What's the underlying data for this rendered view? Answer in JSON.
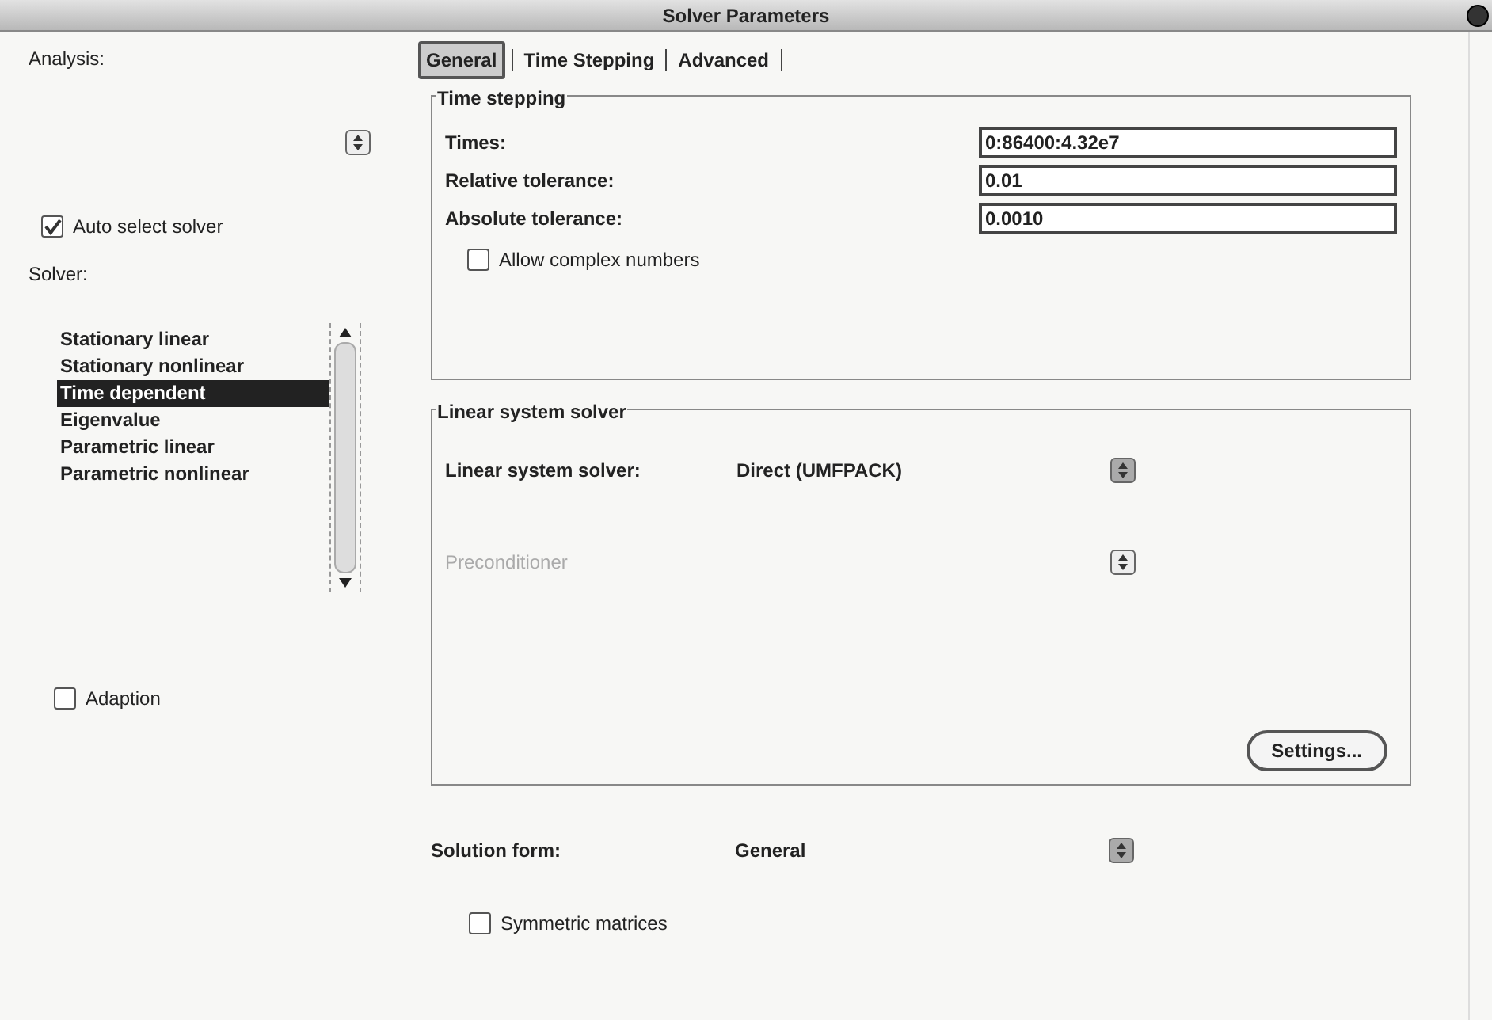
{
  "window": {
    "title": "Solver Parameters"
  },
  "analysis": {
    "label": "Analysis:"
  },
  "auto_select": {
    "label": "Auto select solver",
    "checked": true
  },
  "solver": {
    "label": "Solver:",
    "items": [
      {
        "label": "Stationary linear",
        "selected": false
      },
      {
        "label": "Stationary nonlinear",
        "selected": false
      },
      {
        "label": "Time dependent",
        "selected": true
      },
      {
        "label": "Eigenvalue",
        "selected": false
      },
      {
        "label": "Parametric linear",
        "selected": false
      },
      {
        "label": "Parametric nonlinear",
        "selected": false
      }
    ]
  },
  "adaption": {
    "label": "Adaption",
    "checked": false
  },
  "tabs": [
    {
      "label": "General",
      "selected": true
    },
    {
      "label": "Time Stepping",
      "selected": false
    },
    {
      "label": "Advanced",
      "selected": false
    }
  ],
  "time_stepping": {
    "title": "Time stepping",
    "fields": [
      {
        "label": "Times:",
        "value": "0:86400:4.32e7"
      },
      {
        "label": "Relative tolerance:",
        "value": "0.01"
      },
      {
        "label": "Absolute tolerance:",
        "value": "0.0010"
      }
    ],
    "complex": {
      "label": "Allow complex numbers",
      "checked": false
    }
  },
  "linear_solver": {
    "title": "Linear system solver",
    "rows": [
      {
        "label": "Linear system solver:",
        "value": "Direct (UMFPACK)",
        "disabled": false
      },
      {
        "label": "Preconditioner",
        "disabled": true
      }
    ],
    "settings_button": "Settings..."
  },
  "solution_form": {
    "label": "Solution form:",
    "value": "General"
  },
  "symmetric": {
    "label": "Symmetric matrices",
    "checked": false
  }
}
